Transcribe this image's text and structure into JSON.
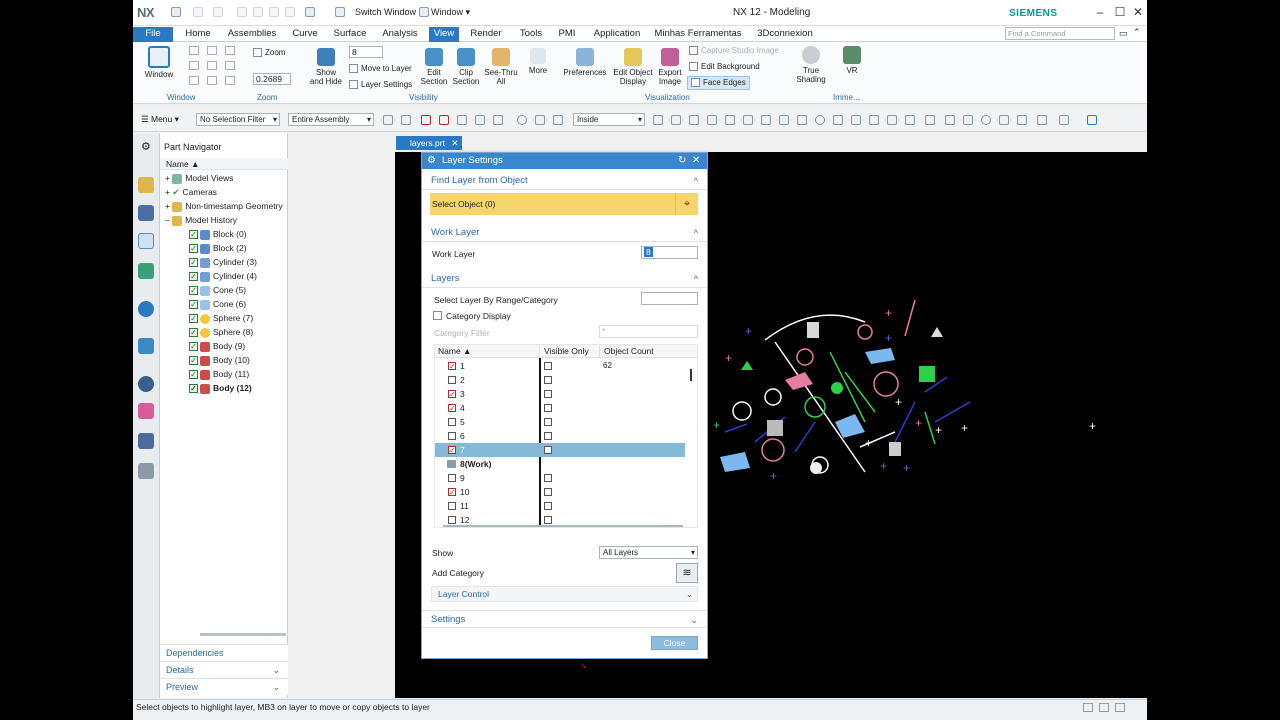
{
  "app": {
    "logo": "NX",
    "title": "NX 12 - Modeling",
    "brand": "SIEMENS",
    "accent": "#2b79c2",
    "quick_access": {
      "switch_window": "Switch Window",
      "window": "Window"
    }
  },
  "search": {
    "placeholder": "Find a Command"
  },
  "tabs": [
    "File",
    "Home",
    "Assemblies",
    "Curve",
    "Surface",
    "Analysis",
    "View",
    "Render",
    "Tools",
    "PMI",
    "Application",
    "Minhas Ferramentas",
    "3Dconnexion"
  ],
  "active_tab": "View",
  "ribbon": {
    "window": {
      "label": "Window",
      "group": "Window"
    },
    "zoom": {
      "label": "Zoom",
      "value": "0.2689",
      "group": "Zoom"
    },
    "layer_value": "8",
    "show_hide": "Show and Hide",
    "move_to_layer": "Move to Layer",
    "layer_settings": "Layer Settings",
    "edit_section": "Edit Section",
    "clip_section": "Clip Section",
    "see_thru": "See-Thru All",
    "more": "More",
    "visibility_group": "Visibility",
    "preferences": "Preferences",
    "edit_object_display": "Edit Object Display",
    "export_image": "Export Image",
    "capture_studio": "Capture Studio Image",
    "edit_background": "Edit Background",
    "face_edges": "Face Edges",
    "visualization_group": "Visualization",
    "true_shading": "True Shading",
    "vr": "VR",
    "imme_group": "Imme..."
  },
  "toolbar": {
    "menu": "Menu",
    "selection_filter": "No Selection Filter",
    "scope": "Entire Assembly",
    "inside": "Inside"
  },
  "part_navigator": {
    "title": "Part Navigator",
    "col_name": "Name",
    "items": [
      {
        "label": "Model Views",
        "level": 1
      },
      {
        "label": "Cameras",
        "level": 1
      },
      {
        "label": "Non-timestamp Geometry",
        "level": 1
      },
      {
        "label": "Model History",
        "level": 1
      },
      {
        "label": "Block (0)",
        "level": 2
      },
      {
        "label": "Block (2)",
        "level": 2
      },
      {
        "label": "Cylinder (3)",
        "level": 2
      },
      {
        "label": "Cylinder (4)",
        "level": 2
      },
      {
        "label": "Cone (5)",
        "level": 2
      },
      {
        "label": "Cone (6)",
        "level": 2
      },
      {
        "label": "Sphere (7)",
        "level": 2
      },
      {
        "label": "Sphere (8)",
        "level": 2
      },
      {
        "label": "Body (9)",
        "level": 2
      },
      {
        "label": "Body (10)",
        "level": 2
      },
      {
        "label": "Body (11)",
        "level": 2
      },
      {
        "label": "Body (12)",
        "level": 2
      }
    ],
    "dependencies": "Dependencies",
    "details": "Details",
    "preview": "Preview"
  },
  "doc_tab": "layers.prt",
  "dialog": {
    "title": "Layer Settings",
    "find_section": "Find Layer from Object",
    "select_object": "Select Object (0)",
    "work_section": "Work Layer",
    "work_layer_label": "Work Layer",
    "work_layer_value": "8",
    "layers_section": "Layers",
    "select_by_range": "Select Layer By Range/Category",
    "category_display": "Category Display",
    "category_filter": "Category Filter",
    "category_filter_value": "*",
    "columns": {
      "name": "Name",
      "visible_only": "Visible Only",
      "object_count": "Object Count"
    },
    "rows": [
      {
        "name": "1",
        "checked": true,
        "count": "62"
      },
      {
        "name": "2",
        "checked": false,
        "count": ""
      },
      {
        "name": "3",
        "checked": true,
        "count": ""
      },
      {
        "name": "4",
        "checked": true,
        "count": ""
      },
      {
        "name": "5",
        "checked": false,
        "count": ""
      },
      {
        "name": "6",
        "checked": false,
        "count": ""
      },
      {
        "name": "7",
        "checked": true,
        "count": "",
        "selected": true
      },
      {
        "name": "8(Work)",
        "work": true,
        "count": ""
      },
      {
        "name": "9",
        "checked": false,
        "count": ""
      },
      {
        "name": "10",
        "checked": true,
        "count": ""
      },
      {
        "name": "11",
        "checked": false,
        "count": ""
      },
      {
        "name": "12",
        "checked": false,
        "count": ""
      }
    ],
    "show_label": "Show",
    "show_value": "All Layers",
    "add_category": "Add Category",
    "layer_control": "Layer Control",
    "settings_section": "Settings",
    "close": "Close"
  },
  "status": "Select objects to highlight layer, MB3 on layer to move or copy objects to layer"
}
